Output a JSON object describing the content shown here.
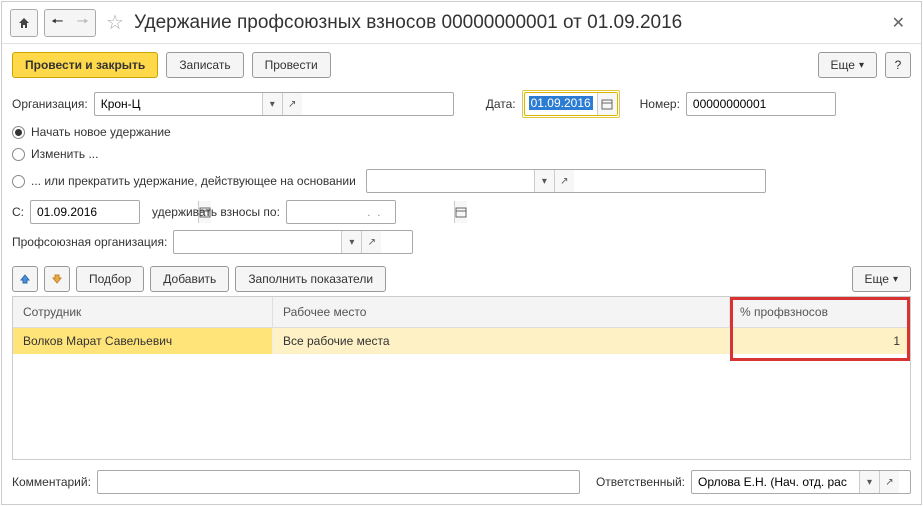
{
  "header": {
    "title": "Удержание профсоюзных взносов 00000000001 от 01.09.2016"
  },
  "toolbar": {
    "post_and_close": "Провести и закрыть",
    "save": "Записать",
    "post": "Провести",
    "more": "Еще",
    "help": "?"
  },
  "form": {
    "org_label": "Организация:",
    "org_value": "Крон-Ц",
    "date_label": "Дата:",
    "date_value": "01.09.2016",
    "number_label": "Номер:",
    "number_value": "00000000001",
    "radio_new": "Начать новое удержание",
    "radio_change": "Изменить ...",
    "radio_stop": "... или прекратить удержание, действующее на основании",
    "from_label": "С:",
    "from_value": "01.09.2016",
    "until_label": "удерживать взносы по:",
    "until_value": "  .  .",
    "union_label": "Профсоюзная организация:",
    "union_value": ""
  },
  "table_toolbar": {
    "pick": "Подбор",
    "add": "Добавить",
    "fill": "Заполнить показатели",
    "more": "Еще"
  },
  "table": {
    "columns": [
      "Сотрудник",
      "Рабочее место",
      "% профвзносов"
    ],
    "rows": [
      {
        "employee": "Волков Марат Савельевич",
        "workplace": "Все рабочие места",
        "percent": "1"
      }
    ]
  },
  "footer": {
    "comment_label": "Комментарий:",
    "comment_value": "",
    "responsible_label": "Ответственный:",
    "responsible_value": "Орлова Е.Н. (Нач. отд. рас"
  }
}
